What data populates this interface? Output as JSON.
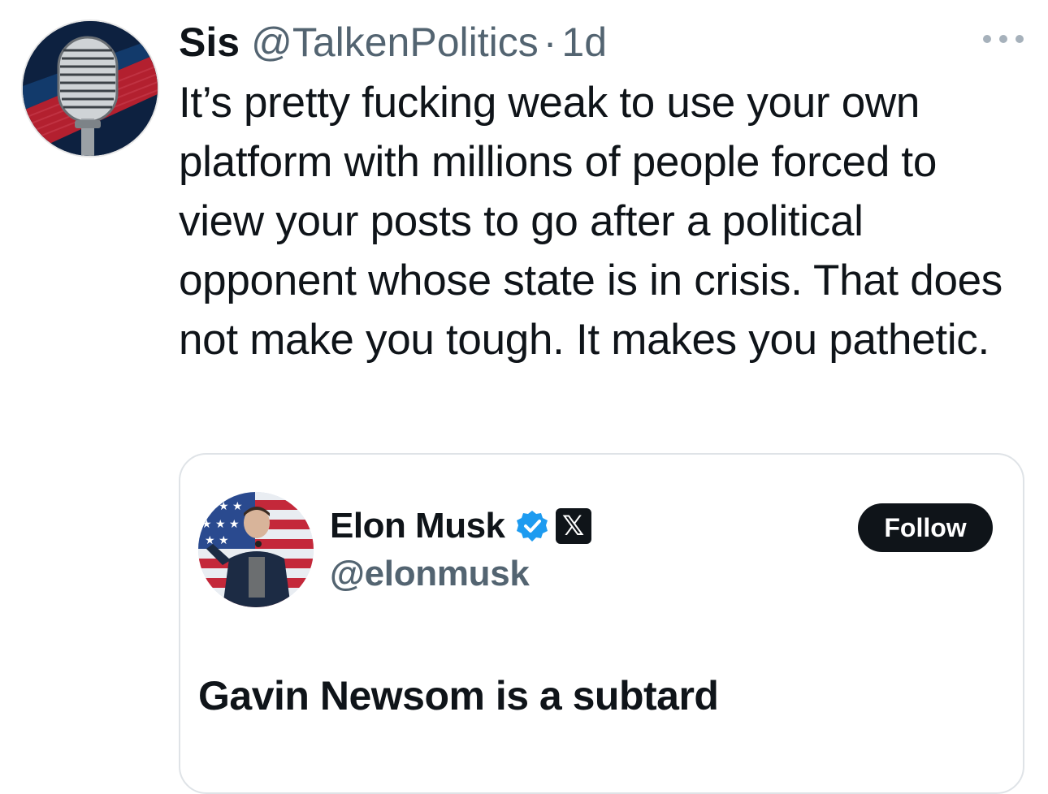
{
  "tweet": {
    "author_name": "Sis",
    "author_handle": "@TalkenPolitics",
    "separator": "·",
    "time": "1d",
    "avatar_icon": "microphone-icon",
    "more_icon": "more-options-icon",
    "text": "It’s pretty fucking weak to use your own platform with millions of people forced to view your posts to go after a political opponent whose state is in crisis. That does not make you tough. It makes you pathetic."
  },
  "quote": {
    "author_name": "Elon Musk",
    "author_handle": "@elonmusk",
    "verified_icon": "verified-badge-icon",
    "affiliation_icon": "x-logo-icon",
    "affiliation_glyph": "𝕏",
    "follow_label": "Follow",
    "text": "Gavin Newsom is a subtard"
  },
  "colors": {
    "text_primary": "#0f1419",
    "text_secondary": "#536471",
    "verified_blue": "#1d9bf0",
    "border": "#dfe3e7"
  }
}
